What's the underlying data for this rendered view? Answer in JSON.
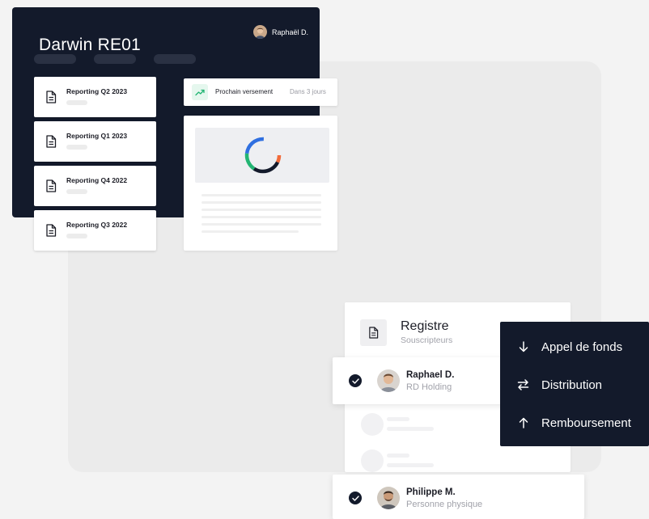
{
  "app": {
    "title": "Darwin RE01",
    "user": {
      "name": "Raphaël D.",
      "avatar": "user-avatar"
    }
  },
  "reports": [
    {
      "label": "Reporting Q2 2023",
      "icon": "document-icon"
    },
    {
      "label": "Reporting Q1 2023",
      "icon": "document-icon"
    },
    {
      "label": "Reporting Q4 2022",
      "icon": "document-icon"
    },
    {
      "label": "Reporting Q3 2022",
      "icon": "document-icon"
    }
  ],
  "versement": {
    "label": "Prochain versement",
    "meta": "Dans 3 jours",
    "icon": "trending-up-icon"
  },
  "chart": {
    "type": "donut",
    "colors": [
      "#f26b3a",
      "#2f6fe0",
      "#22b573",
      "#131a2b"
    ]
  },
  "registre": {
    "title": "Registre",
    "subtitle": "Souscripteurs",
    "icon": "document-icon",
    "members": [
      {
        "name": "Raphael D.",
        "role": "RD Holding",
        "checked": true
      },
      {
        "name": "Philippe M.",
        "role": "Personne physique",
        "checked": true
      }
    ]
  },
  "menu": {
    "items": [
      {
        "label": "Appel de fonds",
        "icon": "arrow-down-icon"
      },
      {
        "label": "Distribution",
        "icon": "swap-arrows-icon"
      },
      {
        "label": "Remboursement",
        "icon": "arrow-up-icon"
      }
    ]
  },
  "colors": {
    "dark": "#131a2b",
    "background": "#f3f3f3",
    "accent_green": "#22b573",
    "muted_text": "#a1a2aa"
  }
}
